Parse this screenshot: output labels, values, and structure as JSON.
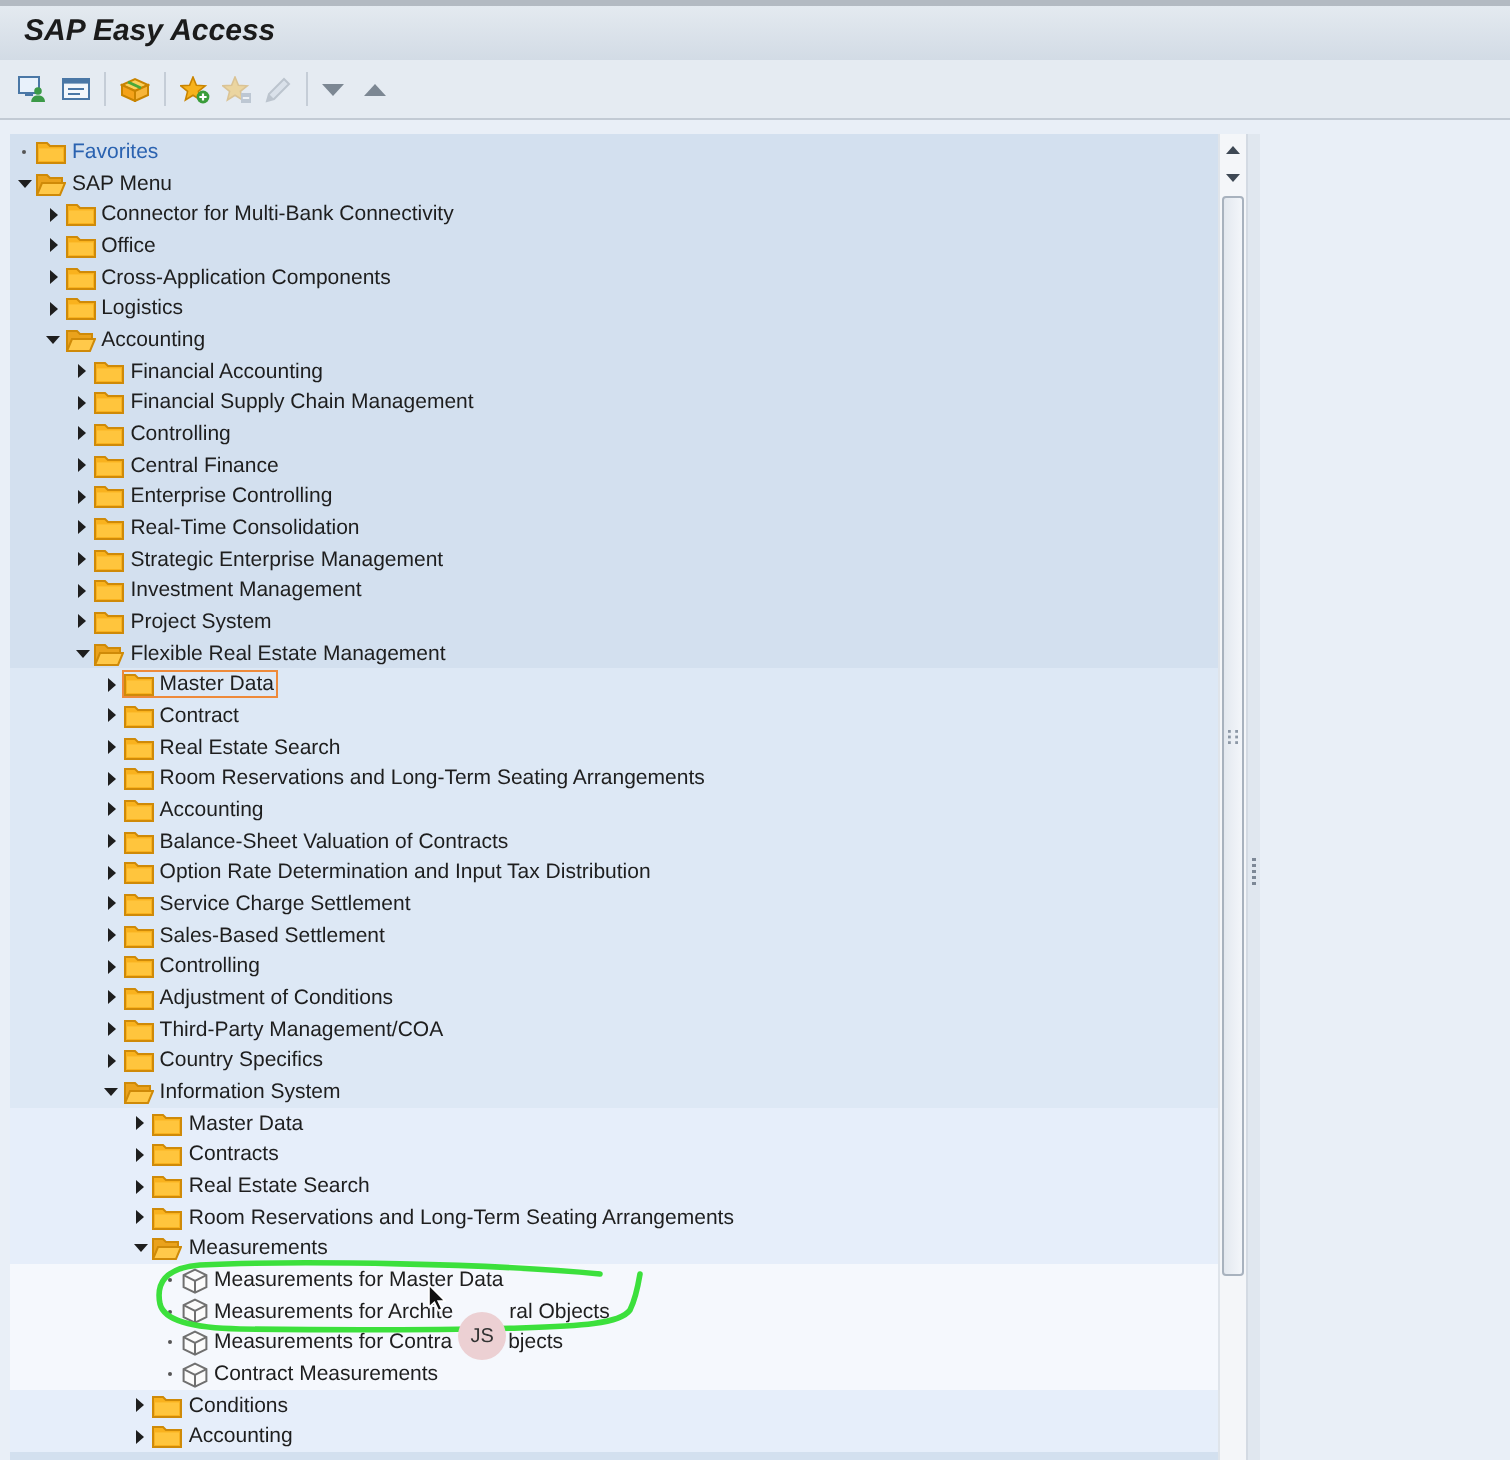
{
  "window": {
    "title": "SAP Easy Access"
  },
  "toolbar": {
    "groups": [
      [
        {
          "disabled": false
        },
        {
          "disabled": false
        }
      ],
      [
        {
          "disabled": false
        }
      ],
      [
        {
          "disabled": false
        },
        {
          "disabled": true
        },
        {
          "disabled": true
        }
      ],
      [
        {
          "disabled": false
        },
        {
          "disabled": false
        }
      ]
    ]
  },
  "tree": {
    "nodes": [
      {
        "label": "Favorites",
        "kind": "favorites",
        "expanded": false,
        "selected": false
      },
      {
        "label": "SAP Menu",
        "kind": "folder",
        "expanded": true,
        "selected": false,
        "children": [
          {
            "label": "Connector for Multi-Bank Connectivity",
            "kind": "folder",
            "expanded": false,
            "selected": false
          },
          {
            "label": "Office",
            "kind": "folder",
            "expanded": false,
            "selected": false
          },
          {
            "label": "Cross-Application Components",
            "kind": "folder",
            "expanded": false,
            "selected": false
          },
          {
            "label": "Logistics",
            "kind": "folder",
            "expanded": false,
            "selected": false
          },
          {
            "label": "Accounting",
            "kind": "folder",
            "expanded": true,
            "selected": false,
            "children": [
              {
                "label": "Financial Accounting",
                "kind": "folder",
                "expanded": false,
                "selected": false
              },
              {
                "label": "Financial Supply Chain Management",
                "kind": "folder",
                "expanded": false,
                "selected": false
              },
              {
                "label": "Controlling",
                "kind": "folder",
                "expanded": false,
                "selected": false
              },
              {
                "label": "Central Finance",
                "kind": "folder",
                "expanded": false,
                "selected": false
              },
              {
                "label": "Enterprise Controlling",
                "kind": "folder",
                "expanded": false,
                "selected": false
              },
              {
                "label": "Real-Time Consolidation",
                "kind": "folder",
                "expanded": false,
                "selected": false
              },
              {
                "label": "Strategic Enterprise Management",
                "kind": "folder",
                "expanded": false,
                "selected": false
              },
              {
                "label": "Investment Management",
                "kind": "folder",
                "expanded": false,
                "selected": false
              },
              {
                "label": "Project System",
                "kind": "folder",
                "expanded": false,
                "selected": false
              },
              {
                "label": "Flexible Real Estate Management",
                "kind": "folder",
                "expanded": true,
                "selected": false,
                "children": [
                  {
                    "label": "Master Data",
                    "kind": "folder",
                    "expanded": false,
                    "selected": true
                  },
                  {
                    "label": "Contract",
                    "kind": "folder",
                    "expanded": false,
                    "selected": false
                  },
                  {
                    "label": "Real Estate Search",
                    "kind": "folder",
                    "expanded": false,
                    "selected": false
                  },
                  {
                    "label": "Room Reservations and Long-Term Seating Arrangements",
                    "kind": "folder",
                    "expanded": false,
                    "selected": false
                  },
                  {
                    "label": "Accounting",
                    "kind": "folder",
                    "expanded": false,
                    "selected": false
                  },
                  {
                    "label": "Balance-Sheet Valuation of Contracts",
                    "kind": "folder",
                    "expanded": false,
                    "selected": false
                  },
                  {
                    "label": "Option Rate Determination and Input Tax Distribution",
                    "kind": "folder",
                    "expanded": false,
                    "selected": false
                  },
                  {
                    "label": "Service Charge Settlement",
                    "kind": "folder",
                    "expanded": false,
                    "selected": false
                  },
                  {
                    "label": "Sales-Based Settlement",
                    "kind": "folder",
                    "expanded": false,
                    "selected": false
                  },
                  {
                    "label": "Controlling",
                    "kind": "folder",
                    "expanded": false,
                    "selected": false
                  },
                  {
                    "label": "Adjustment of Conditions",
                    "kind": "folder",
                    "expanded": false,
                    "selected": false
                  },
                  {
                    "label": "Third-Party Management/COA",
                    "kind": "folder",
                    "expanded": false,
                    "selected": false
                  },
                  {
                    "label": "Country Specifics",
                    "kind": "folder",
                    "expanded": false,
                    "selected": false
                  },
                  {
                    "label": "Information System",
                    "kind": "folder",
                    "expanded": true,
                    "selected": false,
                    "children": [
                      {
                        "label": "Master Data",
                        "kind": "folder",
                        "expanded": false,
                        "selected": false
                      },
                      {
                        "label": "Contracts",
                        "kind": "folder",
                        "expanded": false,
                        "selected": false
                      },
                      {
                        "label": "Real Estate Search",
                        "kind": "folder",
                        "expanded": false,
                        "selected": false
                      },
                      {
                        "label": "Room Reservations and Long-Term Seating Arrangements",
                        "kind": "folder",
                        "expanded": false,
                        "selected": false
                      },
                      {
                        "label": "Measurements",
                        "kind": "folder",
                        "expanded": true,
                        "selected": false,
                        "children": [
                          {
                            "label": "Measurements for Master Data",
                            "kind": "transaction",
                            "selected": false
                          },
                          {
                            "label_parts": [
                              "Measurements for Archite",
                              "ral Objects"
                            ],
                            "kind": "transaction",
                            "selected": false
                          },
                          {
                            "label_parts": [
                              "Measurements for Contra",
                              "bjects"
                            ],
                            "kind": "transaction",
                            "selected": false
                          },
                          {
                            "label": "Contract Measurements",
                            "kind": "transaction",
                            "selected": false
                          }
                        ]
                      },
                      {
                        "label": "Conditions",
                        "kind": "folder",
                        "expanded": false,
                        "selected": false
                      },
                      {
                        "label": "Accounting",
                        "kind": "folder",
                        "expanded": false,
                        "selected": false
                      }
                    ]
                  }
                ]
              }
            ]
          }
        ]
      }
    ]
  },
  "presenter_badge": {
    "initials": "JS"
  }
}
